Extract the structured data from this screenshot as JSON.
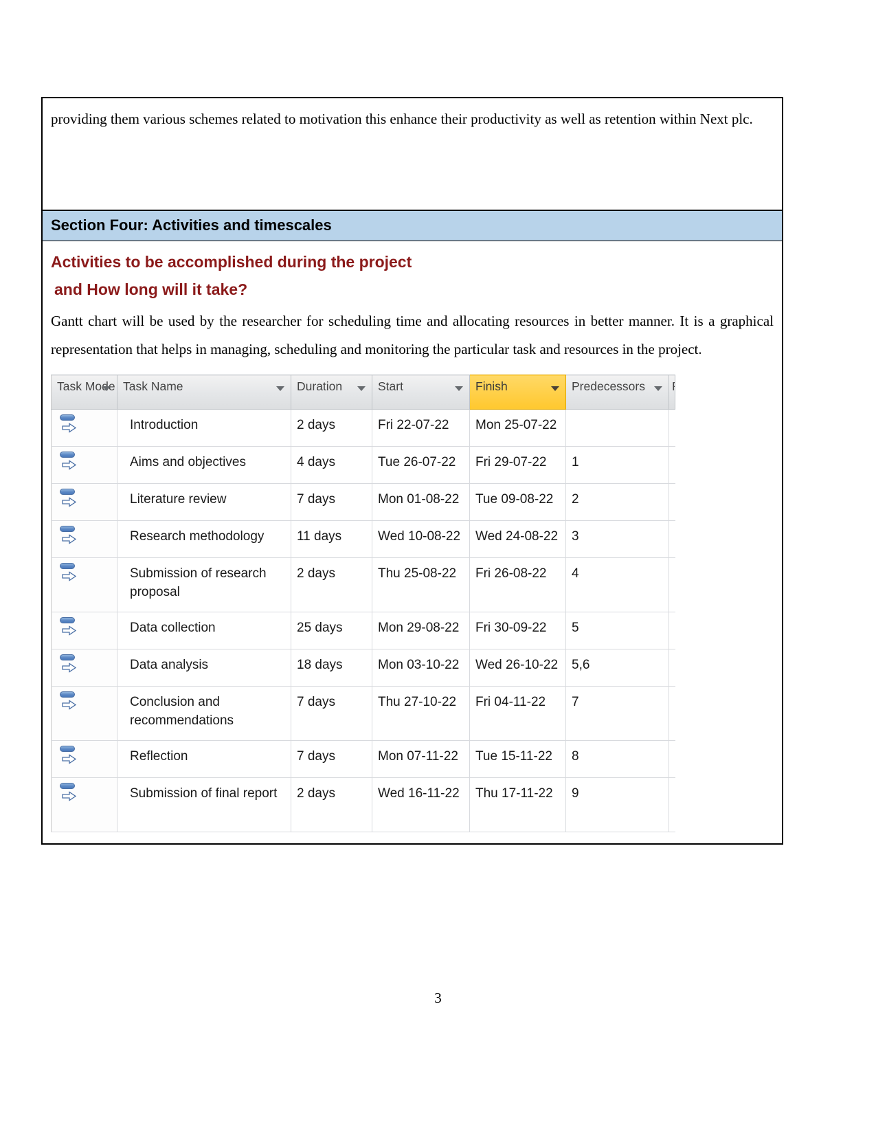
{
  "document": {
    "intro_paragraph": "providing them various schemes related to motivation this enhance their productivity as well as retention within Next plc.",
    "section_band": "Section Four: Activities and timescales",
    "heading_line_1": "Activities to be accomplished during the project",
    "heading_line_2": "and How long will it take?",
    "body_paragraph": "Gantt chart will be used by the researcher for scheduling time and allocating resources in better manner. It is a graphical representation that helps in managing, scheduling and monitoring the particular task and resources in the project.",
    "page_number": "3"
  },
  "colors": {
    "section_band_background": "#b8d3ea",
    "heading_red": "#8b1a1a",
    "highlight_column": "#ffcf47",
    "task_mode_icon_blue": "#5b87c4"
  },
  "gantt": {
    "columns": [
      {
        "key": "mode",
        "label": "Task Mode",
        "has_filter_caret": true,
        "highlighted": false
      },
      {
        "key": "name",
        "label": "Task Name",
        "has_filter_caret": true,
        "highlighted": false
      },
      {
        "key": "dur",
        "label": "Duration",
        "has_filter_caret": true,
        "highlighted": false
      },
      {
        "key": "start",
        "label": "Start",
        "has_filter_caret": true,
        "highlighted": false
      },
      {
        "key": "finish",
        "label": "Finish",
        "has_filter_caret": true,
        "highlighted": true
      },
      {
        "key": "pred",
        "label": "Predecessors",
        "has_filter_caret": true,
        "highlighted": false
      },
      {
        "key": "res",
        "label": "R",
        "has_filter_caret": false,
        "highlighted": false
      }
    ],
    "task_mode_icon": "auto-scheduled-icon",
    "rows": [
      {
        "mode_icon": "auto-scheduled-icon",
        "name": "Introduction",
        "duration": "2 days",
        "start": "Fri 22-07-22",
        "finish": "Mon 25-07-22",
        "predecessors": ""
      },
      {
        "mode_icon": "auto-scheduled-icon",
        "name": "Aims and objectives",
        "duration": "4 days",
        "start": "Tue 26-07-22",
        "finish": "Fri 29-07-22",
        "predecessors": "1"
      },
      {
        "mode_icon": "auto-scheduled-icon",
        "name": "Literature review",
        "duration": "7 days",
        "start": "Mon 01-08-22",
        "finish": "Tue 09-08-22",
        "predecessors": "2"
      },
      {
        "mode_icon": "auto-scheduled-icon",
        "name": "Research methodology",
        "duration": "11 days",
        "start": "Wed 10-08-22",
        "finish": "Wed 24-08-22",
        "predecessors": "3"
      },
      {
        "mode_icon": "auto-scheduled-icon",
        "name": "Submission of research proposal",
        "duration": "2 days",
        "start": "Thu 25-08-22",
        "finish": "Fri 26-08-22",
        "predecessors": "4"
      },
      {
        "mode_icon": "auto-scheduled-icon",
        "name": "Data collection",
        "duration": "25 days",
        "start": "Mon 29-08-22",
        "finish": "Fri 30-09-22",
        "predecessors": "5"
      },
      {
        "mode_icon": "auto-scheduled-icon",
        "name": "Data analysis",
        "duration": "18 days",
        "start": "Mon 03-10-22",
        "finish": "Wed 26-10-22",
        "predecessors": "5,6"
      },
      {
        "mode_icon": "auto-scheduled-icon",
        "name": "Conclusion and recommendations",
        "duration": "7 days",
        "start": "Thu 27-10-22",
        "finish": "Fri 04-11-22",
        "predecessors": "7"
      },
      {
        "mode_icon": "auto-scheduled-icon",
        "name": "Reflection",
        "duration": "7 days",
        "start": "Mon 07-11-22",
        "finish": "Tue 15-11-22",
        "predecessors": "8"
      },
      {
        "mode_icon": "auto-scheduled-icon",
        "name": "Submission of final report",
        "duration": "2 days",
        "start": "Wed 16-11-22",
        "finish": "Thu 17-11-22",
        "predecessors": "9"
      }
    ]
  }
}
